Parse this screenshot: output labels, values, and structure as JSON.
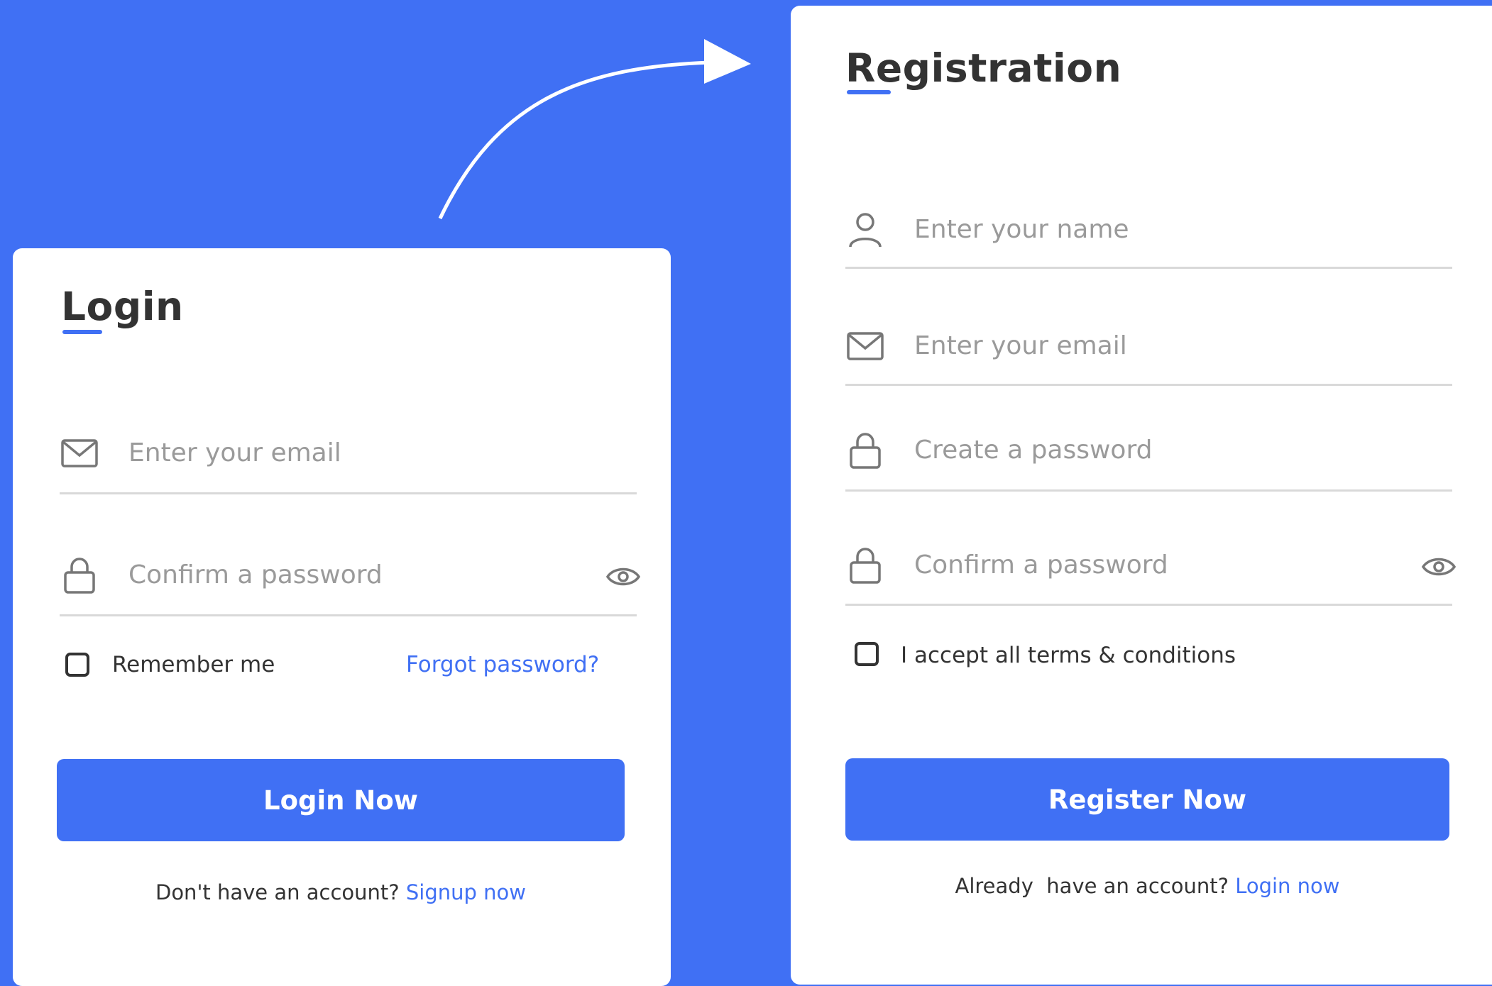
{
  "colors": {
    "accent": "#4070f4",
    "text": "#333333",
    "placeholder": "#9a9a9a",
    "divider": "#d9d9d9",
    "card": "#ffffff"
  },
  "login": {
    "title": "Login",
    "email_placeholder": "Enter your email",
    "password_placeholder": "Confirm a password",
    "remember_label": "Remember me",
    "forgot_link": "Forgot password?",
    "submit_label": "Login Now",
    "footer_text": "Don't have an account?",
    "footer_link": "Signup now",
    "icons": {
      "email": "envelope-icon",
      "password": "lock-icon",
      "toggle": "eye-icon"
    }
  },
  "registration": {
    "title": "Registration",
    "name_placeholder": "Enter your name",
    "email_placeholder": "Enter your email",
    "password_placeholder": "Create a password",
    "confirm_placeholder": "Confirm a password",
    "terms_label": "I accept all terms & conditions",
    "submit_label": "Register Now",
    "footer_text": "Already  have an account?",
    "footer_link": "Login now",
    "icons": {
      "name": "user-icon",
      "email": "envelope-icon",
      "password": "lock-icon",
      "confirm": "lock-icon",
      "toggle": "eye-icon"
    }
  }
}
